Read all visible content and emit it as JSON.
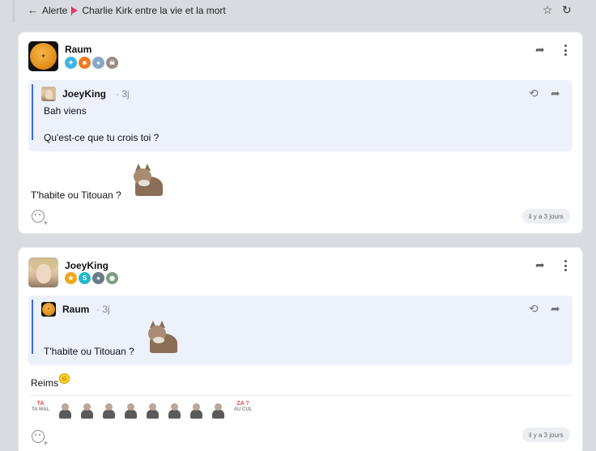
{
  "topbar": {
    "back_icon": "arrow-left-icon",
    "category": "Alerte",
    "thread_title": "Charlie Kirk entre la vie et la mort",
    "star_icon": "star-icon",
    "refresh_icon": "refresh-icon"
  },
  "colors": {
    "background": "#d9dbe0",
    "quote_bg": "#ecf1fc",
    "quote_bar": "#3d6fd8"
  },
  "posts": [
    {
      "author": "Raum",
      "badges": [
        "blue-badge",
        "orange-ghost-badge",
        "photo-badge",
        "skull-badge"
      ],
      "quote": {
        "author": "JoeyKing",
        "time": "· 3j",
        "lines": [
          "Bah viens",
          "Qu'est-ce que tu crois toi ?"
        ]
      },
      "text": "T'habite ou Titouan ?",
      "sticker": "cat-sticker",
      "time_pill": "il y a 3 jours"
    },
    {
      "author": "JoeyKing",
      "badges": [
        "star-badge",
        "s-badge",
        "photo-badge",
        "ball-badge"
      ],
      "quote": {
        "author": "Raum",
        "time": "· 3j",
        "lines": [
          "T'habite ou Titouan ?"
        ]
      },
      "text": "Reims",
      "emoji": "smiley-emoji",
      "stickers_text": {
        "first_top": "TA",
        "first_bottom": "TA MAL",
        "last_top": "ZA ?",
        "last_bottom": "AU CUL"
      },
      "time_pill": "il y a 3 jours"
    }
  ]
}
